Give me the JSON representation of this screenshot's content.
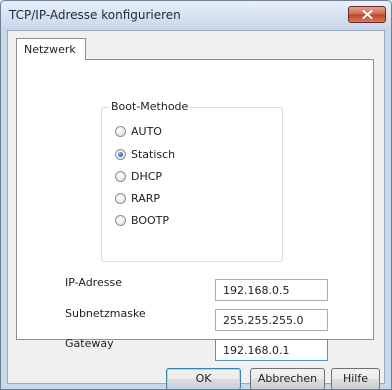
{
  "window": {
    "title": "TCP/IP-Adresse konfigurieren"
  },
  "tabs": [
    {
      "label": "Netzwerk",
      "selected": true
    }
  ],
  "boot_method": {
    "label": "Boot-Methode",
    "options": [
      {
        "label": "AUTO",
        "checked": false
      },
      {
        "label": "Statisch",
        "checked": true
      },
      {
        "label": "DHCP",
        "checked": false
      },
      {
        "label": "RARP",
        "checked": false
      },
      {
        "label": "BOOTP",
        "checked": false
      }
    ]
  },
  "fields": [
    {
      "label": "IP-Adresse",
      "value": "192.168.0.5"
    },
    {
      "label": "Subnetzmaske",
      "value": "255.255.255.0"
    },
    {
      "label": "Gateway",
      "value": "192.168.0.1"
    }
  ],
  "buttons": {
    "ok": "OK",
    "cancel": "Abbrechen",
    "help": "Hilfe"
  },
  "colors": {
    "accent": "#3c7fb1",
    "close_button": "#c04428",
    "selected_radio": "#2b62b8"
  }
}
